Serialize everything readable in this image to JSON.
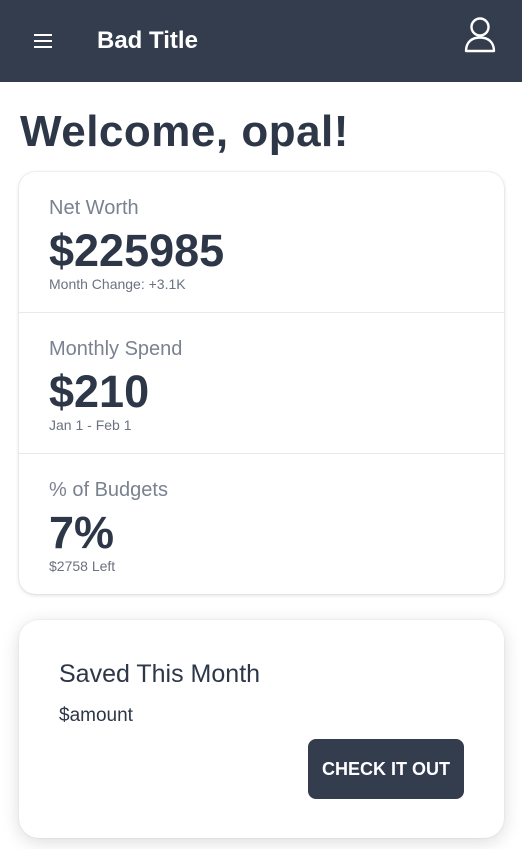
{
  "header": {
    "title": "Bad Title",
    "menu_icon": "hamburger-menu-icon",
    "profile_icon": "user-profile-icon",
    "background": "#343d4e"
  },
  "welcome": {
    "text": "Welcome, opal!"
  },
  "stats": [
    {
      "label": "Net Worth",
      "value": "$225985",
      "sub": "Month Change: +3.1K"
    },
    {
      "label": "Monthly Spend",
      "value": "$210",
      "sub": "Jan 1 - Feb 1"
    },
    {
      "label": "% of Budgets",
      "value": "7%",
      "sub": "$2758 Left"
    }
  ],
  "saved": {
    "title": "Saved This Month",
    "amount": "$amount",
    "button_label": "CHECK IT OUT"
  },
  "colors": {
    "primary_dark": "#343d4e",
    "text_dark": "#2d3748",
    "label_gray": "#7a8290"
  }
}
